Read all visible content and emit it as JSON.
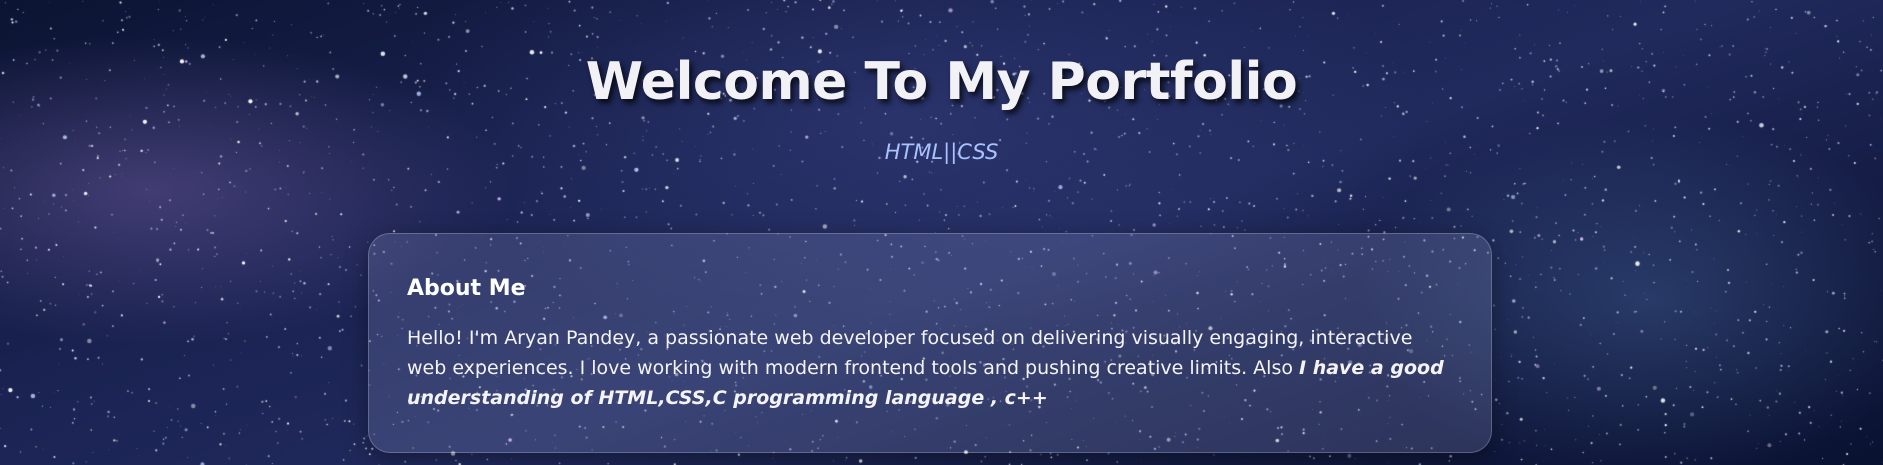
{
  "hero": {
    "title": "Welcome To My Portfolio",
    "subtitle": "HTML||CSS"
  },
  "about": {
    "heading": "About Me",
    "text": "Hello! I'm Aryan Pandey, a passionate web developer focused on delivering visually engaging, interactive web experiences. I love working with modern frontend tools and pushing creative limits. Also ",
    "emphasis": "I have a good understanding of HTML,CSS,C programming language , c++"
  },
  "colors": {
    "background": "#1a2352",
    "title": "#f2f2f6",
    "subtitle": "#a9c3ff",
    "card_background": "rgba(150,160,210,0.22)"
  }
}
